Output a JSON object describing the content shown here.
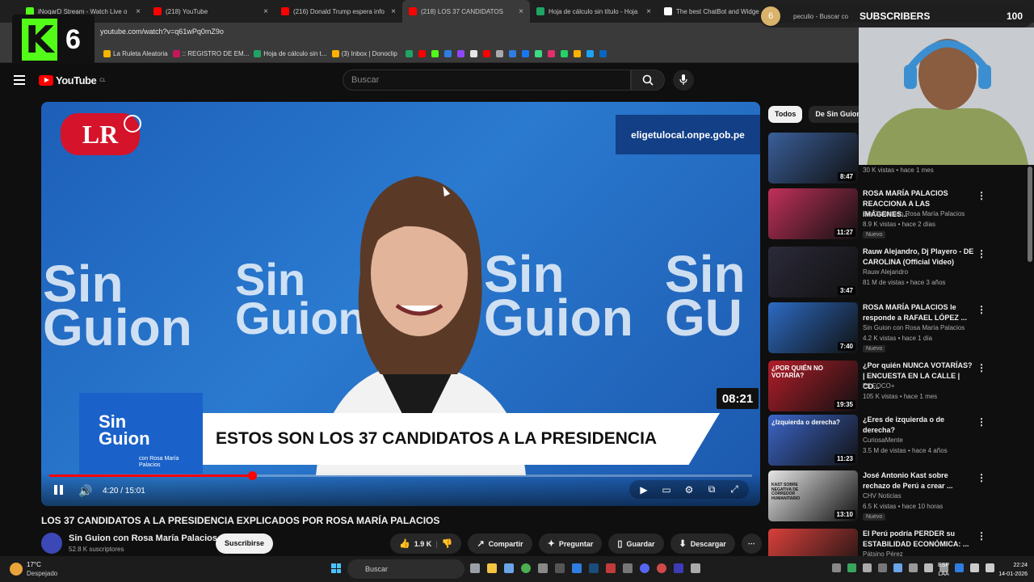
{
  "browser": {
    "tabs": [
      {
        "title": "iNoqarD Stream - Watch Live o",
        "color": "#53fc18",
        "active": false
      },
      {
        "title": "(218) YouTube",
        "color": "#ff0000",
        "active": false
      },
      {
        "title": "(216) Donald Trump espera info",
        "color": "#ff0000",
        "active": false
      },
      {
        "title": "(218) LOS 37 CANDIDATOS",
        "color": "#ff0000",
        "active": true
      },
      {
        "title": "Hoja de cálculo sin título - Hoja",
        "color": "#1fa463",
        "active": false
      },
      {
        "title": "The best ChatBot and Widge",
        "color": "#ffffff",
        "active": false
      }
    ],
    "url": "youtube.com/watch?v=q61wPq0mZ9o",
    "bookmarks": [
      {
        "label": "La Ruleta Aleatoria",
        "color": "#f4b400"
      },
      {
        "label": ":: REGISTRO DE EM...",
        "color": "#c2185b"
      },
      {
        "label": "Hoja de cálculo sin t...",
        "color": "#1fa463"
      },
      {
        "label": "(3) Inbox | Donoclip",
        "color": "#ffb300"
      }
    ]
  },
  "overlays": {
    "k6_label": "6",
    "k_label": "K",
    "subs_label": "SUBSCRIBERS",
    "subs_value": "100",
    "subs_circle": "6",
    "subs_peek": "peculio - Buscar co"
  },
  "youtube": {
    "logo_text": "YouTube",
    "logo_region": "CL",
    "search_placeholder": "Buscar"
  },
  "video": {
    "brand_logo": "LR",
    "site_url": "eligetulocal.onpe.gob.pe",
    "countdown": "08:21",
    "lower_logo_line1": "Sin",
    "lower_logo_line2": "Guion",
    "lower_logo_sub1": "con Rosa María",
    "lower_logo_sub2": "Palacios",
    "banner_text": "ESTOS SON LOS 37 CANDIDATOS A LA PRESIDENCIA",
    "time_display": "4:20 / 15:01",
    "progress_fraction": 0.289,
    "title": "LOS 37 CANDIDATOS A LA PRESIDENCIA EXPLICADOS POR ROSA MARÍA PALACIOS"
  },
  "channel": {
    "name": "Sin Guion con Rosa María Palacios",
    "subscribers": "52.8 K suscriptores",
    "subscribe_label": "Suscribirse"
  },
  "actions": {
    "likes": "1.9 K",
    "share": "Compartir",
    "ask": "Preguntar",
    "save": "Guardar",
    "download": "Descargar"
  },
  "sidebar": {
    "chips": [
      "Todos",
      "De Sin Guion c"
    ],
    "items": [
      {
        "title": "",
        "channel": "",
        "meta": "30 K vistas • hace 1 mes",
        "duration": "8:47",
        "badge": "",
        "thumb": "#3a5f9a"
      },
      {
        "title": "ROSA MARÍA PALACIOS REACCIONA A LAS IMÁGENES...",
        "channel": "Sin Guion con Rosa María Palacios",
        "meta": "8.9 K vistas • hace 2 días",
        "duration": "11:27",
        "badge": "Nuevo",
        "thumb": "#c2305a"
      },
      {
        "title": "Rauw Alejandro, Dj Playero - DE CAROLINA (Official Video)",
        "channel": "Rauw Alejandro",
        "meta": "81 M de vistas • hace 3 años",
        "duration": "3:47",
        "badge": "",
        "thumb": "#2b2a3a"
      },
      {
        "title": "ROSA MARÍA PALACIOS le responde a RAFAEL LÓPEZ ...",
        "channel": "Sin Guion con Rosa María Palacios",
        "meta": "4.2 K vistas • hace 1 día",
        "duration": "7:40",
        "badge": "Nuevo",
        "thumb": "#2c6bc4"
      },
      {
        "title": "¿Por quién NUNCA VOTARÍAS? | ENCUESTA EN LA CALLE | CD...",
        "channel": "EL FOCO+",
        "meta": "105 K vistas • hace 1 mes",
        "duration": "19:35",
        "badge": "",
        "thumb": "#b21d2a"
      },
      {
        "title": "¿Eres de izquierda o de derecha?",
        "channel": "CuriosaMente",
        "meta": "3.5 M de vistas • hace 4 años",
        "duration": "11:23",
        "badge": "",
        "thumb": "#3c66c9"
      },
      {
        "title": "José Antonio Kast sobre rechazo de Perú a crear ...",
        "channel": "CHV Noticias",
        "meta": "6.5 K vistas • hace 10 horas",
        "duration": "13:10",
        "badge": "Nuevo",
        "thumb": "#e6e6e6"
      },
      {
        "title": "El Perú podría PERDER su ESTABILIDAD ECONÓMICA: ...",
        "channel": "Pátsino Pérez",
        "meta": "",
        "duration": "",
        "badge": "",
        "thumb": "#d9403b"
      }
    ],
    "thumb_texts": [
      "¿POR QUIÉN NO VOTARÍA?",
      "¿Izquierda o derecha?",
      "KAST SOBRE NEGATIVA DE CORREDOR HUMANITARIO"
    ]
  },
  "taskbar": {
    "temp": "17°C",
    "condition": "Despejado",
    "search": "Buscar",
    "lang1": "ESP",
    "lang2": "LAA",
    "time": "22:24",
    "date": "14-01-2026"
  }
}
